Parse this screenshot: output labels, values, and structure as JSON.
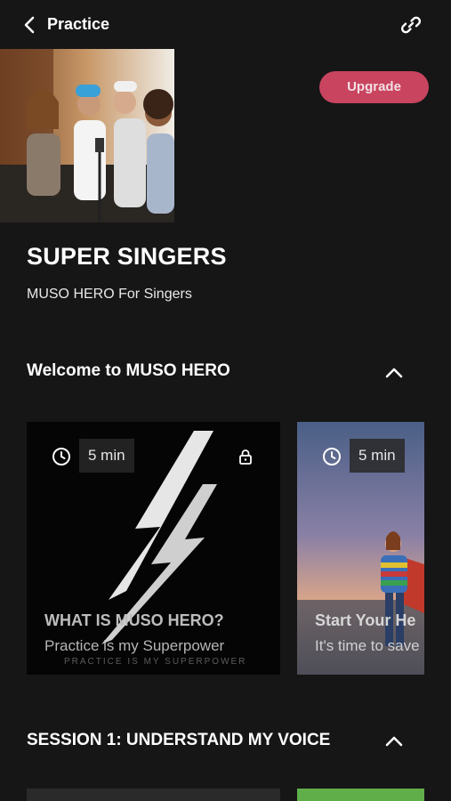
{
  "header": {
    "title": "Practice",
    "back_icon": "chevron-left-icon",
    "share_icon": "link-icon"
  },
  "upgrade_label": "Upgrade",
  "course": {
    "title": "SUPER SINGERS",
    "subtitle": "MUSO HERO For Singers"
  },
  "sections": [
    {
      "title": "Welcome to MUSO HERO",
      "expanded": true
    },
    {
      "title": "SESSION 1: UNDERSTAND MY VOICE",
      "expanded": true
    }
  ],
  "cards": [
    {
      "duration": "5 min",
      "title": "WHAT IS MUSO HERO?",
      "description": "Practice is my Superpower",
      "logo_text": "MUSO HERO",
      "tagline": "PRACTICE IS MY SUPERPOWER",
      "locked": true
    },
    {
      "duration": "5 min",
      "title": "Start Your He",
      "description": "It's time to save",
      "locked": false
    }
  ],
  "colors": {
    "background": "#161616",
    "upgrade": "#c8445f",
    "card": "#050505"
  }
}
